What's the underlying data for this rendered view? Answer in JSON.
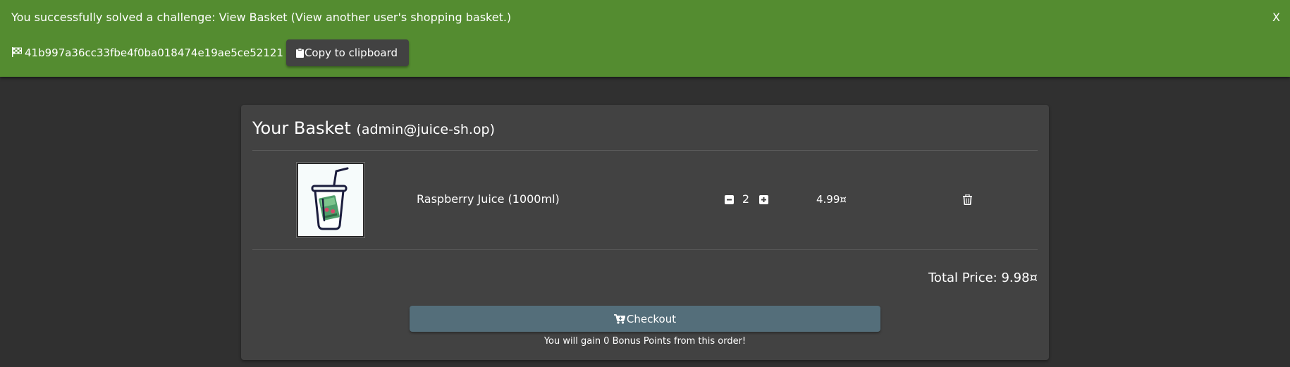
{
  "notification": {
    "message": "You successfully solved a challenge: View Basket (View another user's shopping basket.)",
    "close_label": "X",
    "flag_icon": "checkered-flag-icon",
    "flag_code": "41b997a36cc33fbe4f0ba018474e19ae5ce52121",
    "copy_button_label": "Copy to clipboard",
    "copy_icon": "clipboard-icon",
    "background_color": "#548c30"
  },
  "basket": {
    "title": "Your Basket",
    "owner_email": "(admin@juice-sh.op)",
    "items": [
      {
        "image_icon": "juice-cup-image",
        "name": "Raspberry Juice (1000ml)",
        "quantity": "2",
        "price": "4.99¤",
        "minus_icon": "minus-square-icon",
        "plus_icon": "plus-square-icon",
        "delete_icon": "trash-icon"
      }
    ],
    "total_price": "Total Price: 9.98¤",
    "checkout": {
      "label": "Checkout",
      "icon": "cart-plus-icon",
      "color": "#546e7a"
    },
    "bonus_text": "You will gain 0 Bonus Points from this order!"
  }
}
